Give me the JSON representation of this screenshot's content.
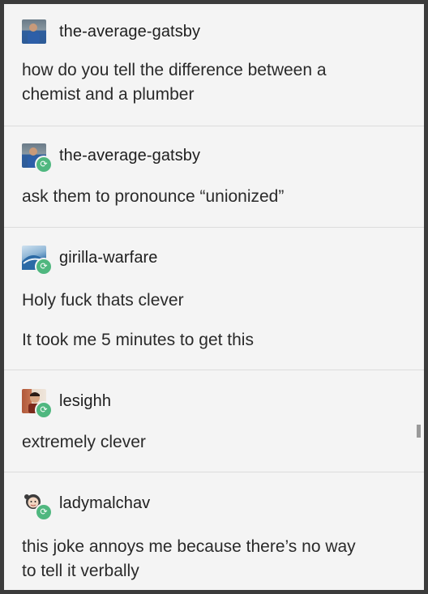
{
  "posts": [
    {
      "username": "the-average-gatsby",
      "avatar_icon": "person-blue-shirt-avatar",
      "reblogged": false,
      "lines": [
        "how do you tell the difference between a",
        "chemist and a plumber"
      ]
    },
    {
      "username": "the-average-gatsby",
      "avatar_icon": "person-blue-shirt-avatar",
      "reblogged": true,
      "lines": [
        "ask them to pronounce “unionized”"
      ]
    },
    {
      "username": "girilla-warfare",
      "avatar_icon": "wave-avatar",
      "reblogged": true,
      "lines": [
        "Holy fuck thats clever",
        "It took me 5 minutes to get this"
      ]
    },
    {
      "username": "lesighh",
      "avatar_icon": "person-portrait-avatar",
      "reblogged": true,
      "lines": [
        "extremely clever"
      ]
    },
    {
      "username": "ladymalchav",
      "avatar_icon": "cartoon-girl-avatar",
      "reblogged": true,
      "lines": [
        "this joke annoys me because there’s no way",
        "to tell it verbally"
      ]
    }
  ],
  "colors": {
    "reblog_badge": "#4fb77f",
    "background": "#f4f4f4",
    "frame": "#3b3b3b"
  }
}
